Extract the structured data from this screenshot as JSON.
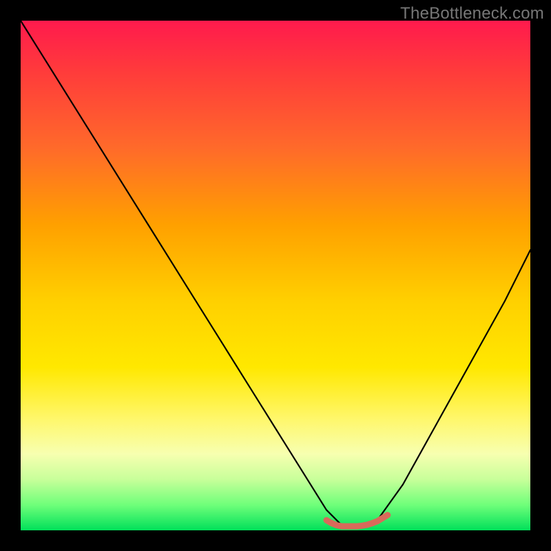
{
  "watermark": "TheBottleneck.com",
  "colors": {
    "frame": "#000000",
    "gradient_top": "#ff1a4d",
    "gradient_bottom": "#00e05a",
    "curve": "#000000",
    "plateau": "#d86a5a"
  },
  "chart_data": {
    "type": "line",
    "title": "",
    "xlabel": "",
    "ylabel": "",
    "xlim": [
      0,
      100
    ],
    "ylim": [
      0,
      100
    ],
    "grid": false,
    "legend": false,
    "series": [
      {
        "name": "bottleneck-curve",
        "color": "#000000",
        "x": [
          0,
          5,
          10,
          15,
          20,
          25,
          30,
          35,
          40,
          45,
          50,
          55,
          60,
          63,
          66,
          70,
          75,
          80,
          85,
          90,
          95,
          100
        ],
        "y": [
          100,
          92,
          84,
          76,
          68,
          60,
          52,
          44,
          36,
          28,
          20,
          12,
          4,
          1,
          1,
          2,
          9,
          18,
          27,
          36,
          45,
          55
        ]
      },
      {
        "name": "optimal-plateau",
        "color": "#d86a5a",
        "x": [
          60,
          61,
          62,
          63,
          64,
          65,
          66,
          67,
          68,
          69,
          70,
          71,
          72
        ],
        "y": [
          2.0,
          1.4,
          1.0,
          0.8,
          0.8,
          0.8,
          0.8,
          0.9,
          1.1,
          1.4,
          1.8,
          2.4,
          3.0
        ]
      }
    ],
    "annotations": []
  }
}
